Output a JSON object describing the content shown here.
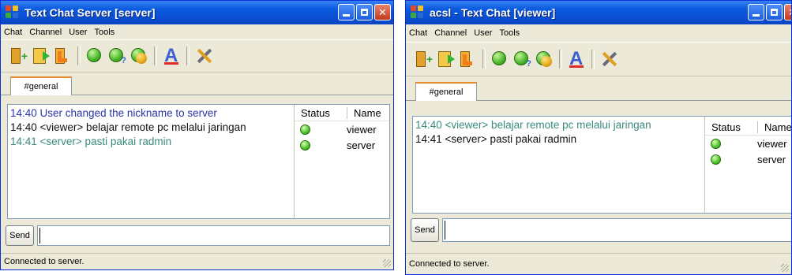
{
  "windows": [
    {
      "title": "Text Chat Server [server]",
      "menu": [
        "Chat",
        "Channel",
        "User",
        "Tools"
      ],
      "tab": "#general",
      "messages": [
        {
          "text": "14:40 User changed the nickname to server",
          "color": "#2836a8"
        },
        {
          "text": "14:40 <viewer> belajar remote pc melalui jaringan",
          "color": "#111111"
        },
        {
          "text": "14:41 <server> pasti pakai radmin",
          "color": "#3a8a7c"
        }
      ],
      "users_header": {
        "status": "Status",
        "name": "Name"
      },
      "users": [
        "viewer",
        "server"
      ],
      "send_label": "Send",
      "input_value": "",
      "status_text": "Connected to server."
    },
    {
      "title": "acsl - Text Chat [viewer]",
      "menu": [
        "Chat",
        "Channel",
        "User",
        "Tools"
      ],
      "tab": "#general",
      "messages": [
        {
          "text": "14:40 <viewer> belajar remote pc melalui jaringan",
          "color": "#3a8a7c"
        },
        {
          "text": "14:41 <server> pasti pakai radmin",
          "color": "#111111"
        }
      ],
      "users_header": {
        "status": "Status",
        "name": "Name"
      },
      "users": [
        "viewer",
        "server"
      ],
      "send_label": "Send",
      "input_value": "",
      "status_text": "Connected to server."
    }
  ],
  "toolbar_icons": [
    "join-channel-icon",
    "leave-channel-icon",
    "exit-icon",
    "user-info-icon",
    "user-question-icon",
    "user-avatar-icon",
    "font-icon",
    "tools-icon"
  ],
  "colors": {
    "titlebar": "#0a5ae0",
    "window_bg": "#ece9d8",
    "tab_accent": "#e68b2c",
    "close_button": "#c23a1a"
  }
}
